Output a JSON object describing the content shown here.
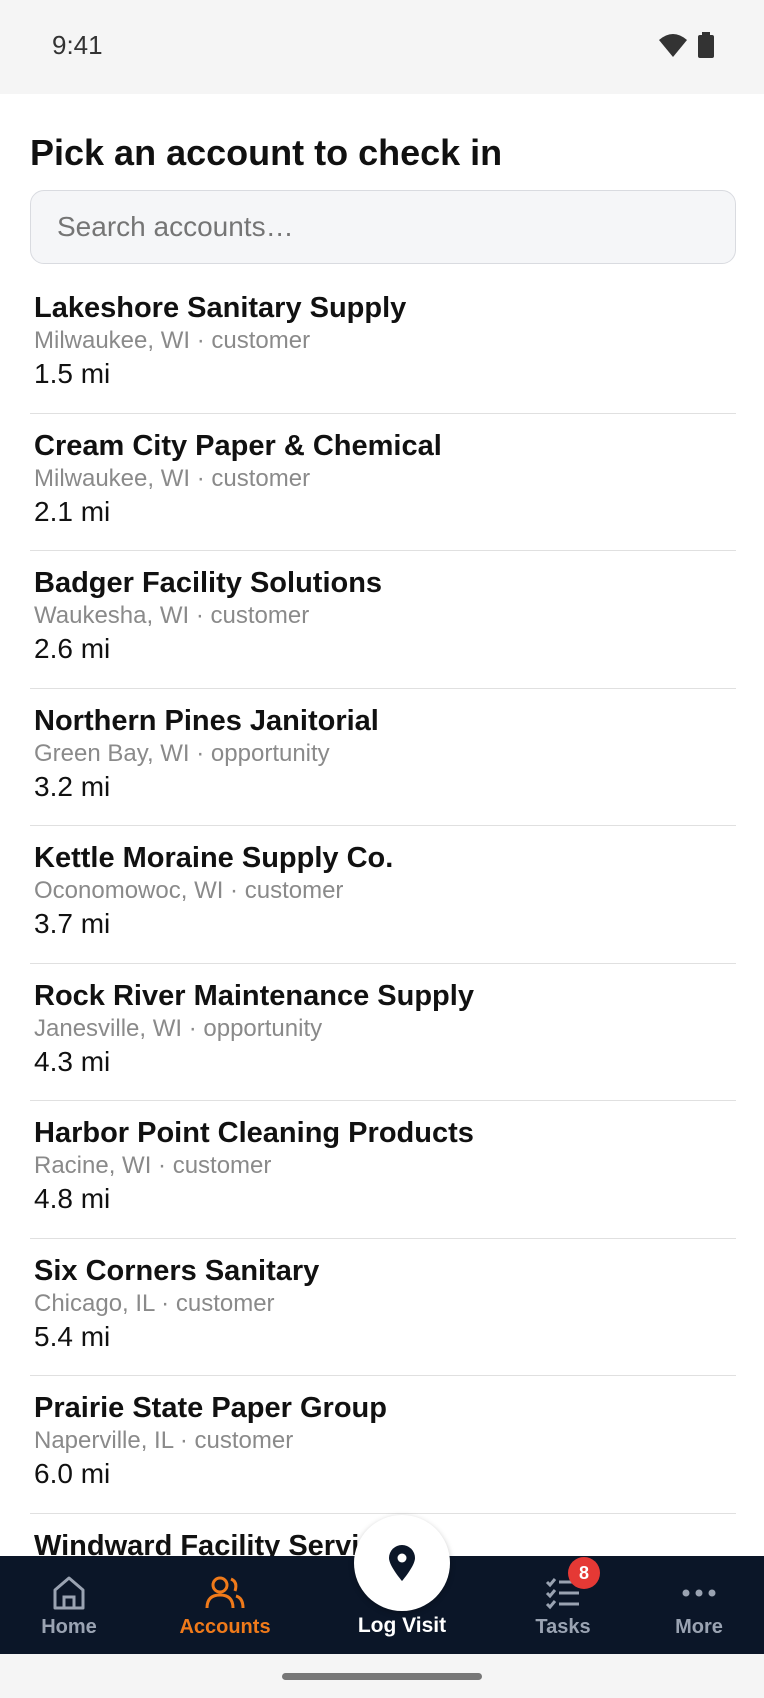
{
  "status_bar": {
    "time": "9:41",
    "icons": [
      "wifi-icon",
      "battery-icon"
    ]
  },
  "page": {
    "title": "Pick an account to check in",
    "search_placeholder": "Search accounts…"
  },
  "accounts": [
    {
      "name": "Lakeshore Sanitary Supply",
      "meta": "Milwaukee, WI · customer",
      "distance": "1.5 mi"
    },
    {
      "name": "Cream City Paper & Chemical",
      "meta": "Milwaukee, WI · customer",
      "distance": "2.1 mi"
    },
    {
      "name": "Badger Facility Solutions",
      "meta": "Waukesha, WI · customer",
      "distance": "2.6 mi"
    },
    {
      "name": "Northern Pines Janitorial",
      "meta": "Green Bay, WI · opportunity",
      "distance": "3.2 mi"
    },
    {
      "name": "Kettle Moraine Supply Co.",
      "meta": "Oconomowoc, WI · customer",
      "distance": "3.7 mi"
    },
    {
      "name": "Rock River Maintenance Supply",
      "meta": "Janesville, WI · opportunity",
      "distance": "4.3 mi"
    },
    {
      "name": "Harbor Point Cleaning Products",
      "meta": "Racine, WI · customer",
      "distance": "4.8 mi"
    },
    {
      "name": "Six Corners Sanitary",
      "meta": "Chicago, IL · customer",
      "distance": "5.4 mi"
    },
    {
      "name": "Prairie State Paper Group",
      "meta": "Naperville, IL · customer",
      "distance": "6.0 mi"
    },
    {
      "name": "Windward Facility Servic",
      "meta": "",
      "distance": ""
    }
  ],
  "nav": {
    "home": "Home",
    "accounts": "Accounts",
    "log_visit": "Log Visit",
    "tasks": "Tasks",
    "tasks_badge": "8",
    "more": "More",
    "active": "accounts"
  },
  "colors": {
    "nav_background": "#0b1628",
    "accent": "#f07a1a",
    "badge": "#e53935"
  }
}
